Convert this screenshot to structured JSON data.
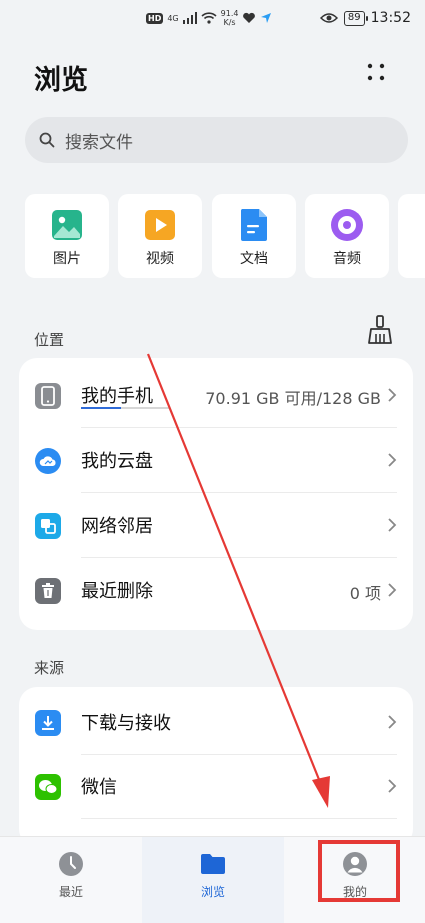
{
  "status_bar": {
    "hd": "HD",
    "net_gen": "4G",
    "speed_value": "91.4",
    "speed_unit": "K/s",
    "battery": "89",
    "time": "13:52"
  },
  "header": {
    "title": "浏览",
    "more_icon": "more-dots-icon"
  },
  "search": {
    "placeholder": "搜索文件"
  },
  "categories": [
    {
      "label": "图片",
      "icon": "image-icon",
      "color": "#27b48c"
    },
    {
      "label": "视频",
      "icon": "video-icon",
      "color": "#f6a623"
    },
    {
      "label": "文档",
      "icon": "document-icon",
      "color": "#2b8cf2"
    },
    {
      "label": "音频",
      "icon": "audio-icon",
      "color": "#9c5cf0"
    }
  ],
  "location": {
    "title": "位置",
    "items": [
      {
        "label": "我的手机",
        "meta": "70.91 GB 可用/128 GB",
        "icon": "phone-icon",
        "usage_fraction": 0.45
      },
      {
        "label": "我的云盘",
        "meta": "",
        "icon": "cloud-icon"
      },
      {
        "label": "网络邻居",
        "meta": "",
        "icon": "network-icon"
      },
      {
        "label": "最近删除",
        "meta": "0 项",
        "icon": "trash-icon"
      }
    ]
  },
  "sources": {
    "title": "来源",
    "items": [
      {
        "label": "下载与接收",
        "icon": "download-icon"
      },
      {
        "label": "微信",
        "icon": "wechat-icon"
      }
    ]
  },
  "bottom_nav": [
    {
      "label": "最近",
      "icon": "clock-icon"
    },
    {
      "label": "浏览",
      "icon": "folder-icon",
      "active": true
    },
    {
      "label": "我的",
      "icon": "profile-icon"
    }
  ],
  "colors": {
    "accent": "#1e66d6",
    "annotation": "#e53935"
  }
}
